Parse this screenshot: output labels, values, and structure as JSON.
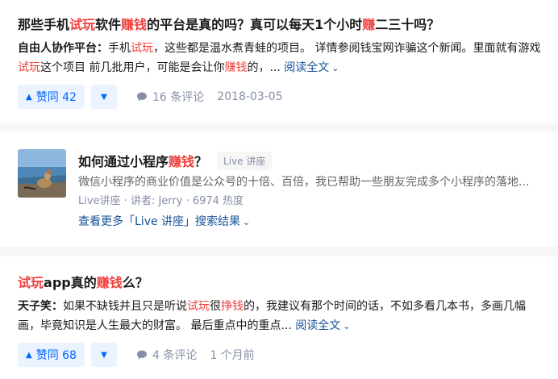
{
  "results": [
    {
      "title_parts": [
        "那些手机",
        "试玩",
        "软件",
        "赚钱",
        "的平台是真的吗？真可以每天1个小时",
        "赚",
        "二三十吗？"
      ],
      "author": "自由人协作平台：",
      "excerpt_parts": [
        "手机",
        "试玩",
        "，这些都是温水煮青蛙的项目。 详情参阅钱宝网诈骗这个新闻。里面就有游戏",
        "试玩",
        "这个项目 前几批用户，可能是会让你",
        "赚钱",
        "的，..."
      ],
      "read_more": "阅读全文",
      "votes": "赞同 42",
      "comments": "16 条评论",
      "date": "2018-03-05"
    },
    {
      "title_parts": [
        "如何通过小程序",
        "赚钱",
        "？"
      ],
      "tag": "Live 讲座",
      "desc": "微信小程序的商业价值是公众号的十倍、百倍，我已帮助一些朋友完成多个小程序的落地...",
      "meta": "Live讲座 · 讲者: Jerry · 6974 热度",
      "more": "查看更多「Live 讲座」搜索结果"
    },
    {
      "title_parts": [
        "试玩",
        "app真的",
        "赚钱",
        "么？"
      ],
      "author": "天子笑：",
      "excerpt_parts": [
        "如果不缺钱并且只是听说",
        "试玩",
        "很",
        "挣钱",
        "的，我建议有那个时间的话，不如多看几本书，多画几幅画，毕竟知识是人生最大的财富。 最后重点中的重点..."
      ],
      "read_more": "阅读全文",
      "votes": "赞同 68",
      "comments": "4 条评论",
      "date": "1 个月前"
    }
  ],
  "colors": {
    "highlight": "#f1403c",
    "link": "#175199",
    "vote_bg": "#ebf3ff",
    "vote_fg": "#0066ff"
  },
  "icons": {
    "vote_up": "triangle-up-icon",
    "vote_down": "triangle-down-icon",
    "comment": "comment-bubble-icon",
    "chevron": "chevron-down-icon"
  }
}
